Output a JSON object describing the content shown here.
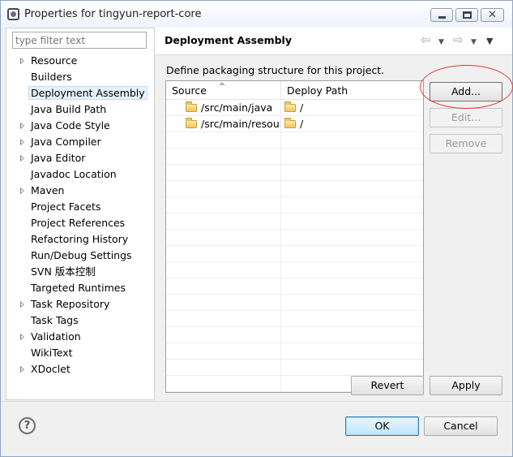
{
  "window": {
    "title": "Properties for tingyun-report-core",
    "close_glyph": "✕"
  },
  "filter": {
    "placeholder": "type filter text"
  },
  "tree": {
    "items": [
      {
        "label": "Resource",
        "expandable": true
      },
      {
        "label": "Builders",
        "expandable": false
      },
      {
        "label": "Deployment Assembly",
        "expandable": false,
        "selected": true
      },
      {
        "label": "Java Build Path",
        "expandable": false
      },
      {
        "label": "Java Code Style",
        "expandable": true
      },
      {
        "label": "Java Compiler",
        "expandable": true
      },
      {
        "label": "Java Editor",
        "expandable": true
      },
      {
        "label": "Javadoc Location",
        "expandable": false
      },
      {
        "label": "Maven",
        "expandable": true
      },
      {
        "label": "Project Facets",
        "expandable": false
      },
      {
        "label": "Project References",
        "expandable": false
      },
      {
        "label": "Refactoring History",
        "expandable": false
      },
      {
        "label": "Run/Debug Settings",
        "expandable": false
      },
      {
        "label": "SVN 版本控制",
        "expandable": false
      },
      {
        "label": "Targeted Runtimes",
        "expandable": false
      },
      {
        "label": "Task Repository",
        "expandable": true
      },
      {
        "label": "Task Tags",
        "expandable": false
      },
      {
        "label": "Validation",
        "expandable": true
      },
      {
        "label": "WikiText",
        "expandable": false
      },
      {
        "label": "XDoclet",
        "expandable": true
      }
    ]
  },
  "page": {
    "title": "Deployment Assembly",
    "description": "Define packaging structure for this project.",
    "nav": {
      "back": "⇦",
      "forward": "⇨",
      "dropdown": "▼",
      "view_menu": "▼"
    }
  },
  "table": {
    "columns": [
      "Source",
      "Deploy Path"
    ],
    "rows": [
      {
        "source": "/src/main/java",
        "deploy": "/"
      },
      {
        "source": "/src/main/resources",
        "deploy": "/"
      }
    ]
  },
  "buttons": {
    "add": "Add...",
    "edit": "Edit...",
    "remove": "Remove",
    "revert": "Revert",
    "apply": "Apply",
    "ok": "OK",
    "cancel": "Cancel",
    "help": "?"
  }
}
